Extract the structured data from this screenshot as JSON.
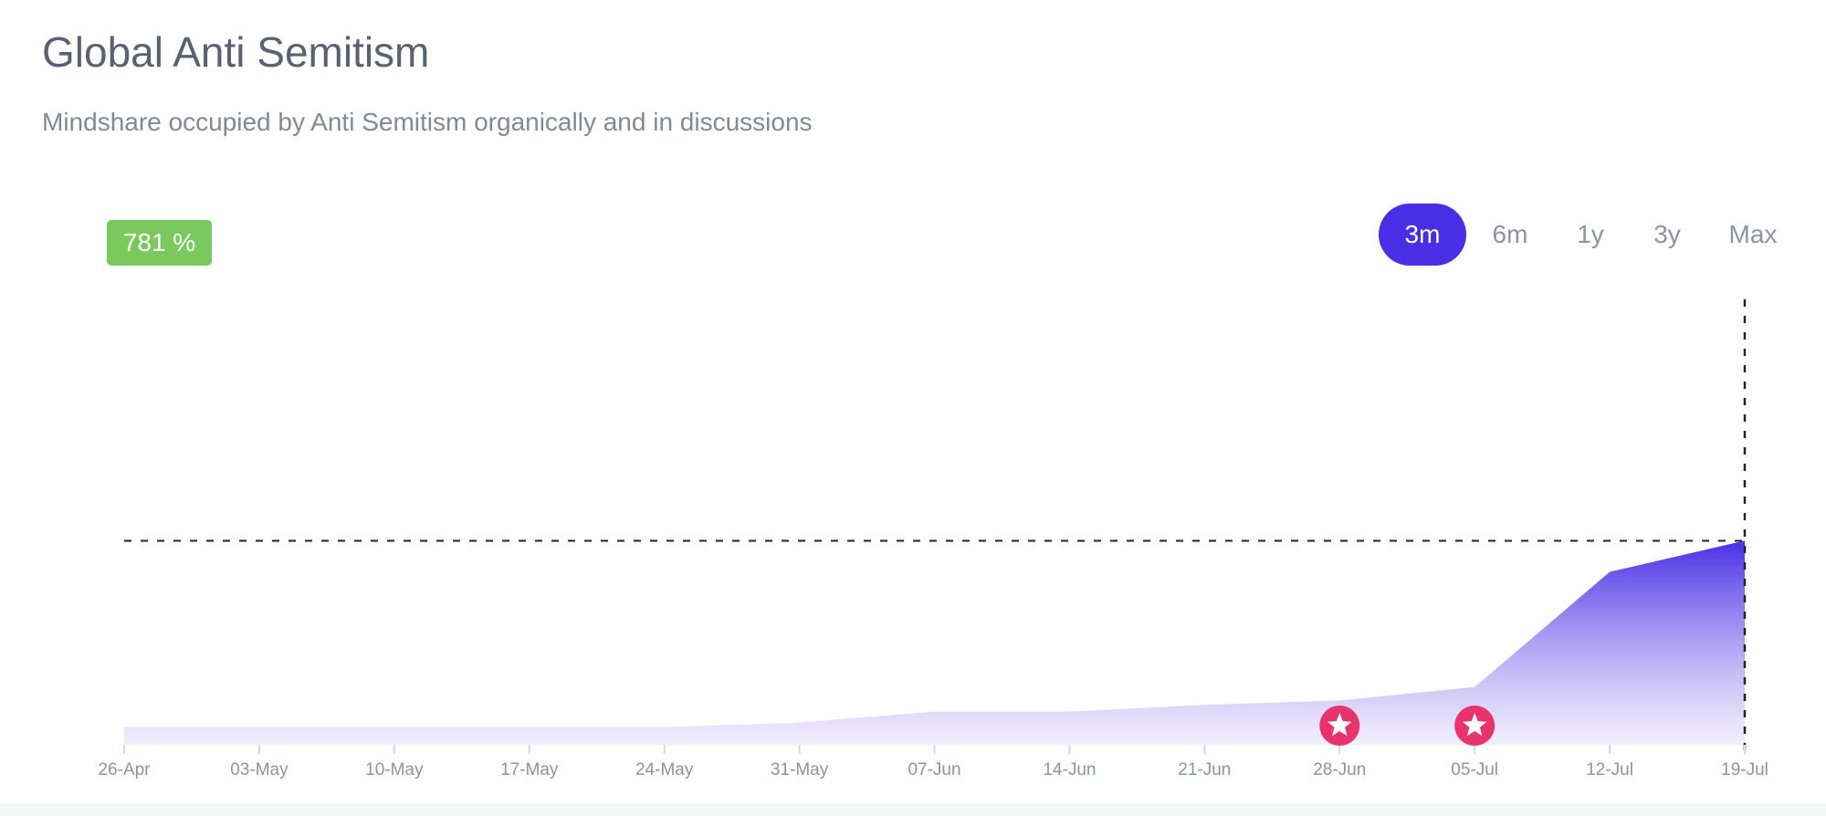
{
  "header": {
    "title": "Global Anti Semitism",
    "subtitle": "Mindshare occupied by Anti Semitism organically and in discussions"
  },
  "change_badge": {
    "value": "781 %",
    "color": "#7ac95c"
  },
  "range_tabs": {
    "items": [
      {
        "label": "3m",
        "active": true
      },
      {
        "label": "6m",
        "active": false
      },
      {
        "label": "1y",
        "active": false
      },
      {
        "label": "3y",
        "active": false
      },
      {
        "label": "Max",
        "active": false
      }
    ],
    "active_color": "#4a2ee6"
  },
  "chart_data": {
    "type": "area",
    "x": [
      "26-Apr",
      "03-May",
      "10-May",
      "17-May",
      "24-May",
      "31-May",
      "07-Jun",
      "14-Jun",
      "21-Jun",
      "28-Jun",
      "05-Jul",
      "12-Jul",
      "19-Jul"
    ],
    "values": [
      4,
      4,
      4,
      4,
      4,
      5,
      7.5,
      7.5,
      9,
      10,
      13,
      39,
      46
    ],
    "ylim": [
      0,
      100
    ],
    "y_axis_shown": false,
    "grid": false,
    "fill_color_top": "#4a2ee6",
    "fill_color_bottom": "#e9e4fb",
    "reference_line": {
      "value": 46,
      "style": "dashed"
    },
    "crosshair_at": "19-Jul",
    "event_markers": [
      {
        "x": "28-Jun",
        "icon": "star-icon",
        "color": "#e8336d"
      },
      {
        "x": "05-Jul",
        "icon": "star-icon",
        "color": "#e8336d"
      }
    ]
  }
}
